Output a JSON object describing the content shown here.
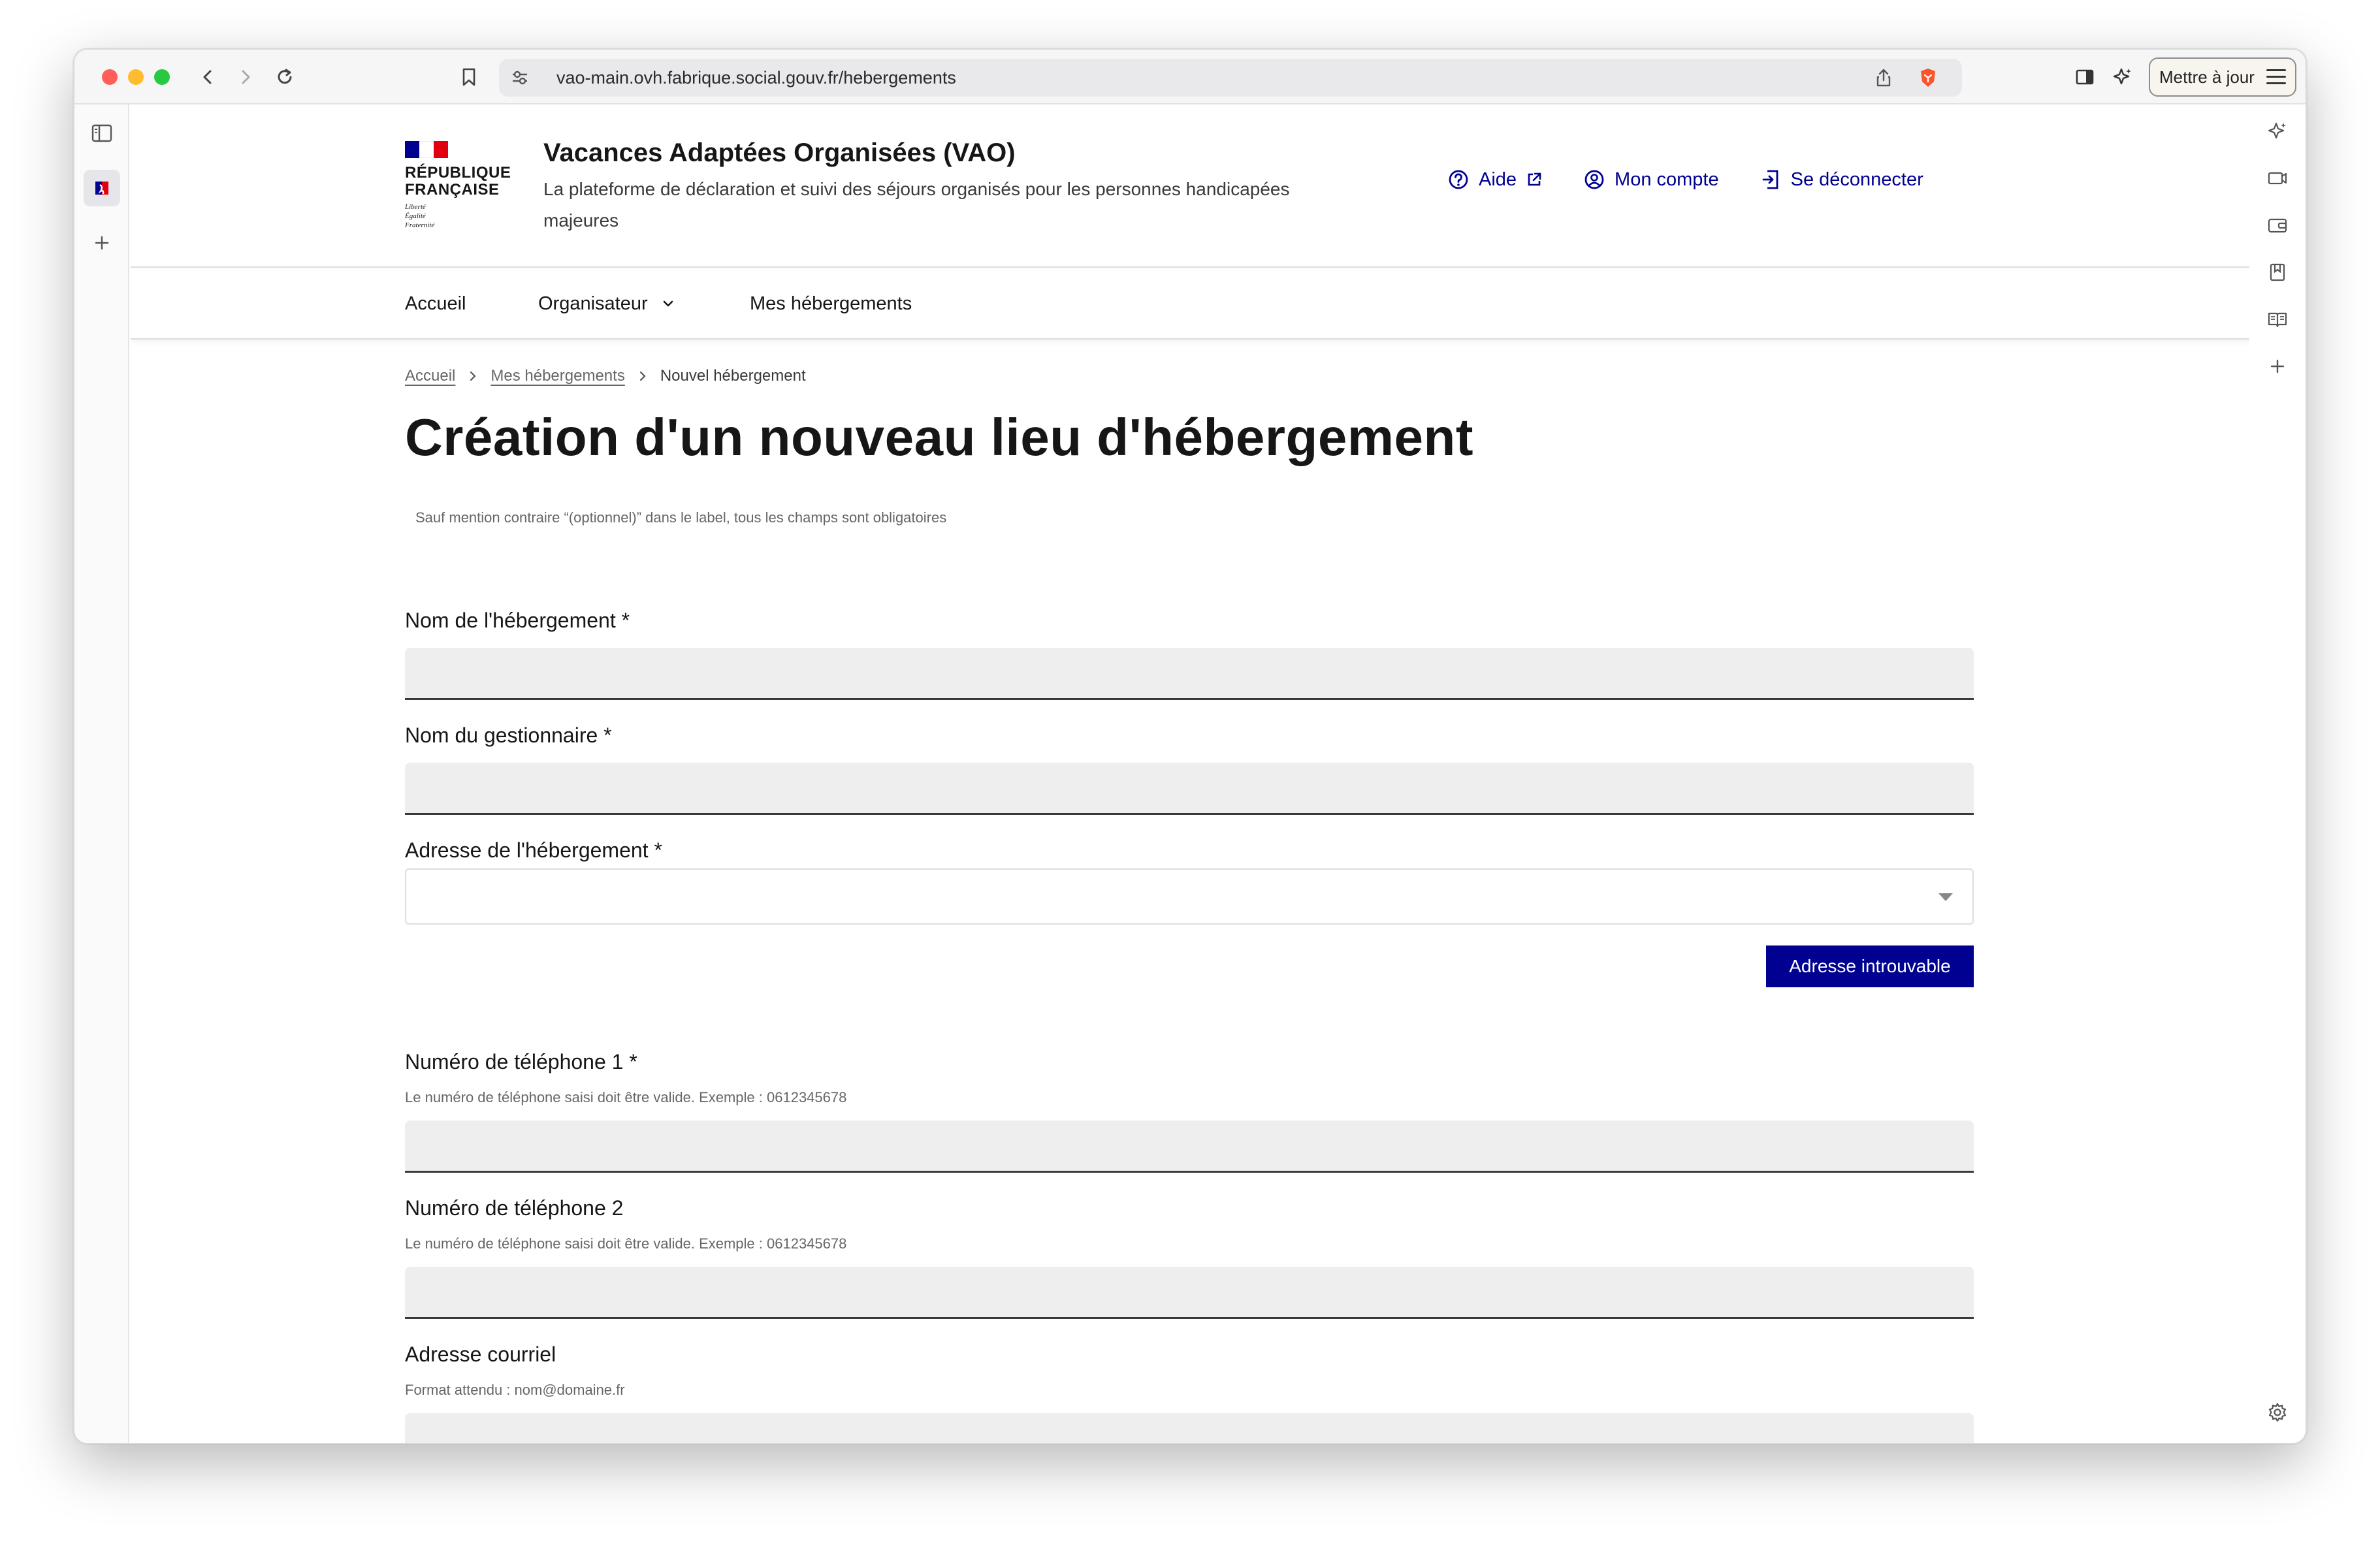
{
  "browser": {
    "url": "vao-main.ovh.fabrique.social.gouv.fr/hebergements",
    "update_label": "Mettre à jour"
  },
  "header": {
    "logo_lines": [
      "RÉPUBLIQUE",
      "FRANÇAISE"
    ],
    "motto_lines": [
      "Liberté",
      "Égalité",
      "Fraternité"
    ],
    "site_title": "Vacances Adaptées Organisées (VAO)",
    "tagline": "La plateforme de déclaration et suivi des séjours organisés pour les personnes handicapées majeures",
    "links": {
      "help": "Aide",
      "account": "Mon compte",
      "logout": "Se déconnecter"
    }
  },
  "nav": {
    "home": "Accueil",
    "organizer": "Organisateur",
    "lodgings": "Mes hébergements"
  },
  "breadcrumb": {
    "home": "Accueil",
    "lodgings": "Mes hébergements",
    "current": "Nouvel hébergement"
  },
  "form": {
    "title": "Création d'un nouveau lieu d'hébergement",
    "required_hint": "Sauf mention contraire “(optionnel)” dans le label, tous les champs sont obligatoires",
    "name_label": "Nom de l'hébergement *",
    "manager_label": "Nom du gestionnaire *",
    "address_label": "Adresse de l'hébergement *",
    "address_not_found": "Adresse introuvable",
    "phone1_label": "Numéro de téléphone 1 *",
    "phone1_hint": "Le numéro de téléphone saisi doit être valide. Exemple : 0612345678",
    "phone2_label": "Numéro de téléphone 2",
    "phone2_hint": "Le numéro de téléphone saisi doit être valide. Exemple : 0612345678",
    "email_label": "Adresse courriel",
    "email_hint": "Format attendu : nom@domaine.fr"
  },
  "colors": {
    "brand_blue": "#000091",
    "flag_red": "#e1000f",
    "input_bg": "#eeeeee"
  }
}
